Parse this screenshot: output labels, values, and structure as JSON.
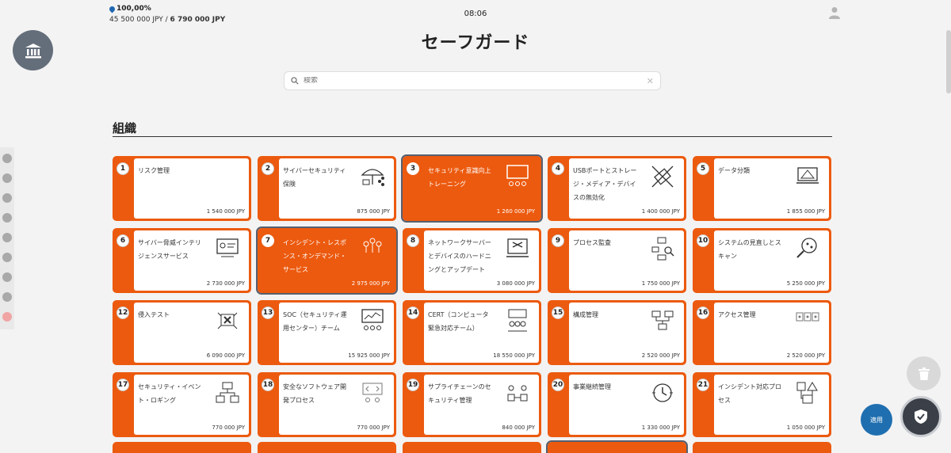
{
  "header": {
    "percentage": "100,00%",
    "budget_spent": "45 500 000 JPY",
    "budget_separator": " / ",
    "budget_total": "6 790 000 JPY",
    "clock": "08:06",
    "page_title": "セーフガード"
  },
  "search": {
    "placeholder": "検索",
    "value": ""
  },
  "section": {
    "title": "組織"
  },
  "buttons": {
    "apply": "適用"
  },
  "colors": {
    "accent": "#ec5a0f",
    "selected_outline": "#566070",
    "apply": "#1f6fb0"
  },
  "cards": [
    {
      "num": "1",
      "name": "リスク管理",
      "price": "1 540 000 JPY",
      "selected": true,
      "icon": "brain-icon"
    },
    {
      "num": "2",
      "name": "サイバーセキュリティ保険",
      "price": "875 000 JPY",
      "selected": false,
      "icon": "umbrella-icon"
    },
    {
      "num": "3",
      "name": "セキュリティ意識向上トレーニング",
      "price": "1 260 000 JPY",
      "selected": true,
      "icon": "presentation-icon"
    },
    {
      "num": "4",
      "name": "USBポートとストレージ・メディア・デバイスの無効化",
      "price": "1 400 000 JPY",
      "selected": false,
      "icon": "usb-blocked-icon"
    },
    {
      "num": "5",
      "name": "データ分類",
      "price": "1 855 000 JPY",
      "selected": false,
      "icon": "laptop-chart-icon"
    },
    {
      "num": "6",
      "name": "サイバー脅威インテリジェンスサービス",
      "price": "2 730 000 JPY",
      "selected": false,
      "icon": "monitor-board-icon"
    },
    {
      "num": "7",
      "name": "インシデント・レスポンス・オンデマンド・サービス",
      "price": "2 975 000 JPY",
      "selected": true,
      "icon": "network-people-icon"
    },
    {
      "num": "8",
      "name": "ネットワークサーバーとデバイスのハードニングとアップデート",
      "price": "3 080 000 JPY",
      "selected": false,
      "icon": "laptop-tools-icon"
    },
    {
      "num": "9",
      "name": "プロセス監査",
      "price": "1 750 000 JPY",
      "selected": false,
      "icon": "flow-search-icon"
    },
    {
      "num": "10",
      "name": "システムの見直しとスキャン",
      "price": "5 250 000 JPY",
      "selected": false,
      "icon": "magnifier-icon"
    },
    {
      "num": "12",
      "name": "侵入テスト",
      "price": "6 090 000 JPY",
      "selected": false,
      "icon": "pentest-icon"
    },
    {
      "num": "13",
      "name": "SOC（セキュリティ運用センター）チーム",
      "price": "15 925 000 JPY",
      "selected": false,
      "icon": "soc-icon"
    },
    {
      "num": "14",
      "name": "CERT（コンピュータ緊急対応チーム）",
      "price": "18 550 000 JPY",
      "selected": false,
      "icon": "team-icon"
    },
    {
      "num": "15",
      "name": "構成管理",
      "price": "2 520 000 JPY",
      "selected": false,
      "icon": "config-icon"
    },
    {
      "num": "16",
      "name": "アクセス管理",
      "price": "2 520 000 JPY",
      "selected": false,
      "icon": "access-icon"
    },
    {
      "num": "17",
      "name": "セキュリティ・イベント・ロギング",
      "price": "770 000 JPY",
      "selected": false,
      "icon": "logging-icon"
    },
    {
      "num": "18",
      "name": "安全なソフトウェア開発プロセス",
      "price": "770 000 JPY",
      "selected": false,
      "icon": "dev-icon"
    },
    {
      "num": "19",
      "name": "サプライチェーンのセキュリティ管理",
      "price": "840 000 JPY",
      "selected": false,
      "icon": "supply-chain-icon"
    },
    {
      "num": "20",
      "name": "事業継続管理",
      "price": "1 330 000 JPY",
      "selected": false,
      "icon": "continuity-icon"
    },
    {
      "num": "21",
      "name": "インシデント対応プロセス",
      "price": "1 050 000 JPY",
      "selected": false,
      "icon": "incident-flow-icon"
    }
  ]
}
